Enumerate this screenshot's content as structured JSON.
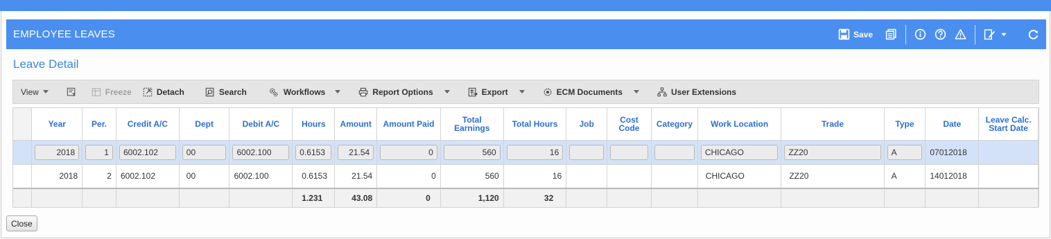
{
  "window": {
    "title": "EMPLOYEE LEAVES"
  },
  "header": {
    "save_label": "Save",
    "icons": [
      "save-icon",
      "report-icon",
      "info-icon",
      "help-icon",
      "warning-icon",
      "edit-icon",
      "dropdown-caret-icon",
      "refresh-icon"
    ]
  },
  "section": {
    "title": "Leave Detail"
  },
  "toolbar": {
    "view": "View",
    "freeze": "Freeze",
    "detach": "Detach",
    "search": "Search",
    "workflows": "Workflows",
    "report_options": "Report Options",
    "export": "Export",
    "ecm_documents": "ECM Documents",
    "user_extensions": "User Extensions"
  },
  "grid": {
    "columns": [
      {
        "label": "Year"
      },
      {
        "label": "Per."
      },
      {
        "label": "Credit A/C"
      },
      {
        "label": "Dept"
      },
      {
        "label": "Debit A/C"
      },
      {
        "label": "Hours"
      },
      {
        "label": "Amount"
      },
      {
        "label": "Amount Paid"
      },
      {
        "label": "Total Earnings"
      },
      {
        "label": "Total Hours"
      },
      {
        "label": "Job"
      },
      {
        "label": "Cost Code"
      },
      {
        "label": "Category"
      },
      {
        "label": "Work Location"
      },
      {
        "label": "Trade"
      },
      {
        "label": "Type"
      },
      {
        "label": "Date"
      },
      {
        "label": "Leave Calc. Start Date"
      }
    ],
    "rows": [
      {
        "year": "2018",
        "per": "1",
        "credit_ac": "6002.102",
        "dept": "00",
        "debit_ac": "6002.100",
        "hours": "0.6153",
        "amount": "21.54",
        "amount_paid": "0",
        "total_earnings": "560",
        "total_hours": "16",
        "job": "",
        "cost_code": "",
        "category": "",
        "work_location": "CHICAGO",
        "trade": "ZZ20",
        "type": "A",
        "date": "07012018",
        "leave_calc_start_date": ""
      },
      {
        "year": "2018",
        "per": "2",
        "credit_ac": "6002.102",
        "dept": "00",
        "debit_ac": "6002.100",
        "hours": "0.6153",
        "amount": "21.54",
        "amount_paid": "0",
        "total_earnings": "560",
        "total_hours": "16",
        "job": "",
        "cost_code": "",
        "category": "",
        "work_location": "CHICAGO",
        "trade": "ZZ20",
        "type": "A",
        "date": "14012018",
        "leave_calc_start_date": ""
      }
    ],
    "totals": {
      "hours": "1.231",
      "amount": "43.08",
      "amount_paid": "0",
      "total_earnings": "1,120",
      "total_hours": "32"
    }
  },
  "footer": {
    "close_label": "Close"
  },
  "colors": {
    "header_blue": "#4a8ff0",
    "selected_row": "#d3e2f8",
    "column_header_text": "#2c6fd0"
  }
}
